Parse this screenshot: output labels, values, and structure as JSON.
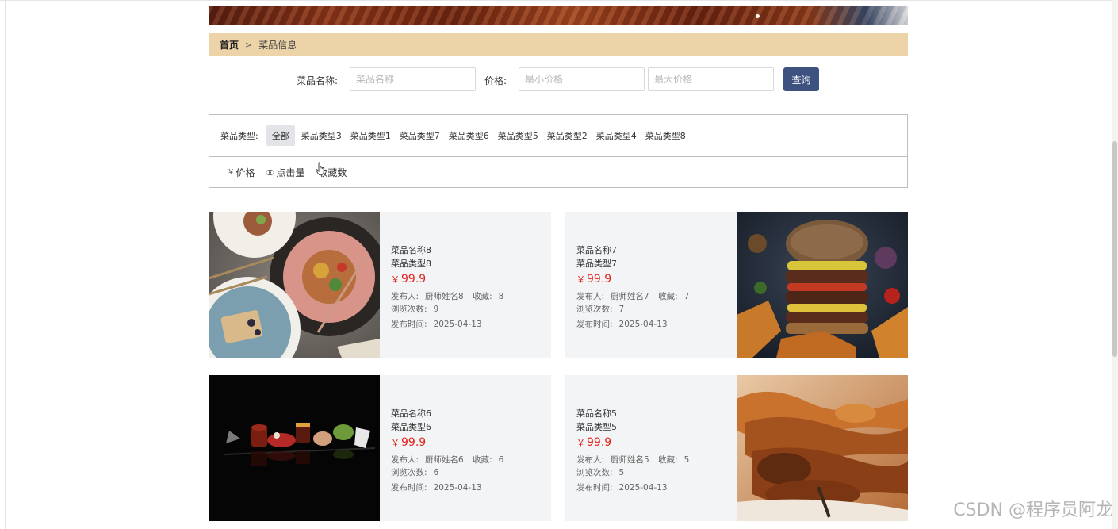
{
  "breadcrumb": {
    "home": "首页",
    "separator": ">",
    "current": "菜品信息"
  },
  "search": {
    "name_label": "菜品名称:",
    "name_placeholder": "菜品名称",
    "price_label": "价格:",
    "min_placeholder": "最小价格",
    "max_placeholder": "最大价格",
    "button_label": "查询"
  },
  "filter": {
    "type_label": "菜品类型:",
    "types": [
      "全部",
      "菜品类型3",
      "菜品类型1",
      "菜品类型7",
      "菜品类型6",
      "菜品类型5",
      "菜品类型2",
      "菜品类型4",
      "菜品类型8"
    ],
    "active_type": "全部"
  },
  "sort": {
    "items": [
      {
        "icon": "yen-icon",
        "glyph": "¥",
        "label": "价格"
      },
      {
        "icon": "eye-icon",
        "label": "点击量"
      },
      {
        "icon": "star-icon",
        "label": "收藏数"
      }
    ]
  },
  "dishes": [
    {
      "name": "菜品名称8",
      "type": "菜品类型8",
      "currency": "￥",
      "price": "99.9",
      "publisher_label": "发布人:",
      "publisher": "厨师姓名8",
      "favorites_label": "收藏:",
      "favorites": "8",
      "views_label": "浏览次数:",
      "views": "9",
      "date_label": "发布时间:",
      "date": "2025-04-13"
    },
    {
      "name": "菜品名称7",
      "type": "菜品类型7",
      "currency": "￥",
      "price": "99.9",
      "publisher_label": "发布人:",
      "publisher": "厨师姓名7",
      "favorites_label": "收藏:",
      "favorites": "7",
      "views_label": "浏览次数:",
      "views": "7",
      "date_label": "发布时间:",
      "date": "2025-04-13"
    },
    {
      "name": "菜品名称6",
      "type": "菜品类型6",
      "currency": "￥",
      "price": "99.9",
      "publisher_label": "发布人:",
      "publisher": "厨师姓名6",
      "favorites_label": "收藏:",
      "favorites": "6",
      "views_label": "浏览次数:",
      "views": "6",
      "date_label": "发布时间:",
      "date": "2025-04-13"
    },
    {
      "name": "菜品名称5",
      "type": "菜品类型5",
      "currency": "￥",
      "price": "99.9",
      "publisher_label": "发布人:",
      "publisher": "厨师姓名5",
      "favorites_label": "收藏:",
      "favorites": "5",
      "views_label": "浏览次数:",
      "views": "5",
      "date_label": "发布时间:",
      "date": "2025-04-13"
    }
  ],
  "watermark": "CSDN @程序员阿龙",
  "colors": {
    "accent": "#3e5280",
    "breadcrumb_bg": "#ecd3a8",
    "price": "#e0231b",
    "card_bg": "#f3f4f6"
  }
}
